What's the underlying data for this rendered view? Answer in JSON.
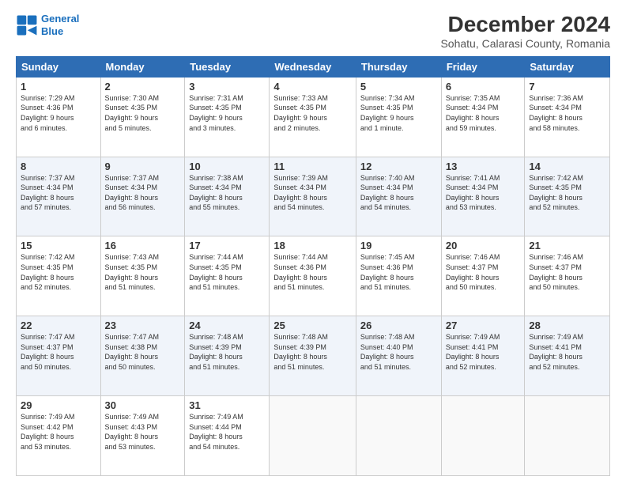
{
  "logo": {
    "line1": "General",
    "line2": "Blue"
  },
  "title": "December 2024",
  "subtitle": "Sohatu, Calarasi County, Romania",
  "weekdays": [
    "Sunday",
    "Monday",
    "Tuesday",
    "Wednesday",
    "Thursday",
    "Friday",
    "Saturday"
  ],
  "weeks": [
    [
      {
        "day": "1",
        "info": "Sunrise: 7:29 AM\nSunset: 4:36 PM\nDaylight: 9 hours\nand 6 minutes."
      },
      {
        "day": "2",
        "info": "Sunrise: 7:30 AM\nSunset: 4:35 PM\nDaylight: 9 hours\nand 5 minutes."
      },
      {
        "day": "3",
        "info": "Sunrise: 7:31 AM\nSunset: 4:35 PM\nDaylight: 9 hours\nand 3 minutes."
      },
      {
        "day": "4",
        "info": "Sunrise: 7:33 AM\nSunset: 4:35 PM\nDaylight: 9 hours\nand 2 minutes."
      },
      {
        "day": "5",
        "info": "Sunrise: 7:34 AM\nSunset: 4:35 PM\nDaylight: 9 hours\nand 1 minute."
      },
      {
        "day": "6",
        "info": "Sunrise: 7:35 AM\nSunset: 4:34 PM\nDaylight: 8 hours\nand 59 minutes."
      },
      {
        "day": "7",
        "info": "Sunrise: 7:36 AM\nSunset: 4:34 PM\nDaylight: 8 hours\nand 58 minutes."
      }
    ],
    [
      {
        "day": "8",
        "info": "Sunrise: 7:37 AM\nSunset: 4:34 PM\nDaylight: 8 hours\nand 57 minutes."
      },
      {
        "day": "9",
        "info": "Sunrise: 7:37 AM\nSunset: 4:34 PM\nDaylight: 8 hours\nand 56 minutes."
      },
      {
        "day": "10",
        "info": "Sunrise: 7:38 AM\nSunset: 4:34 PM\nDaylight: 8 hours\nand 55 minutes."
      },
      {
        "day": "11",
        "info": "Sunrise: 7:39 AM\nSunset: 4:34 PM\nDaylight: 8 hours\nand 54 minutes."
      },
      {
        "day": "12",
        "info": "Sunrise: 7:40 AM\nSunset: 4:34 PM\nDaylight: 8 hours\nand 54 minutes."
      },
      {
        "day": "13",
        "info": "Sunrise: 7:41 AM\nSunset: 4:34 PM\nDaylight: 8 hours\nand 53 minutes."
      },
      {
        "day": "14",
        "info": "Sunrise: 7:42 AM\nSunset: 4:35 PM\nDaylight: 8 hours\nand 52 minutes."
      }
    ],
    [
      {
        "day": "15",
        "info": "Sunrise: 7:42 AM\nSunset: 4:35 PM\nDaylight: 8 hours\nand 52 minutes."
      },
      {
        "day": "16",
        "info": "Sunrise: 7:43 AM\nSunset: 4:35 PM\nDaylight: 8 hours\nand 51 minutes."
      },
      {
        "day": "17",
        "info": "Sunrise: 7:44 AM\nSunset: 4:35 PM\nDaylight: 8 hours\nand 51 minutes."
      },
      {
        "day": "18",
        "info": "Sunrise: 7:44 AM\nSunset: 4:36 PM\nDaylight: 8 hours\nand 51 minutes."
      },
      {
        "day": "19",
        "info": "Sunrise: 7:45 AM\nSunset: 4:36 PM\nDaylight: 8 hours\nand 51 minutes."
      },
      {
        "day": "20",
        "info": "Sunrise: 7:46 AM\nSunset: 4:37 PM\nDaylight: 8 hours\nand 50 minutes."
      },
      {
        "day": "21",
        "info": "Sunrise: 7:46 AM\nSunset: 4:37 PM\nDaylight: 8 hours\nand 50 minutes."
      }
    ],
    [
      {
        "day": "22",
        "info": "Sunrise: 7:47 AM\nSunset: 4:37 PM\nDaylight: 8 hours\nand 50 minutes."
      },
      {
        "day": "23",
        "info": "Sunrise: 7:47 AM\nSunset: 4:38 PM\nDaylight: 8 hours\nand 50 minutes."
      },
      {
        "day": "24",
        "info": "Sunrise: 7:48 AM\nSunset: 4:39 PM\nDaylight: 8 hours\nand 51 minutes."
      },
      {
        "day": "25",
        "info": "Sunrise: 7:48 AM\nSunset: 4:39 PM\nDaylight: 8 hours\nand 51 minutes."
      },
      {
        "day": "26",
        "info": "Sunrise: 7:48 AM\nSunset: 4:40 PM\nDaylight: 8 hours\nand 51 minutes."
      },
      {
        "day": "27",
        "info": "Sunrise: 7:49 AM\nSunset: 4:41 PM\nDaylight: 8 hours\nand 52 minutes."
      },
      {
        "day": "28",
        "info": "Sunrise: 7:49 AM\nSunset: 4:41 PM\nDaylight: 8 hours\nand 52 minutes."
      }
    ],
    [
      {
        "day": "29",
        "info": "Sunrise: 7:49 AM\nSunset: 4:42 PM\nDaylight: 8 hours\nand 53 minutes."
      },
      {
        "day": "30",
        "info": "Sunrise: 7:49 AM\nSunset: 4:43 PM\nDaylight: 8 hours\nand 53 minutes."
      },
      {
        "day": "31",
        "info": "Sunrise: 7:49 AM\nSunset: 4:44 PM\nDaylight: 8 hours\nand 54 minutes."
      },
      null,
      null,
      null,
      null
    ]
  ]
}
